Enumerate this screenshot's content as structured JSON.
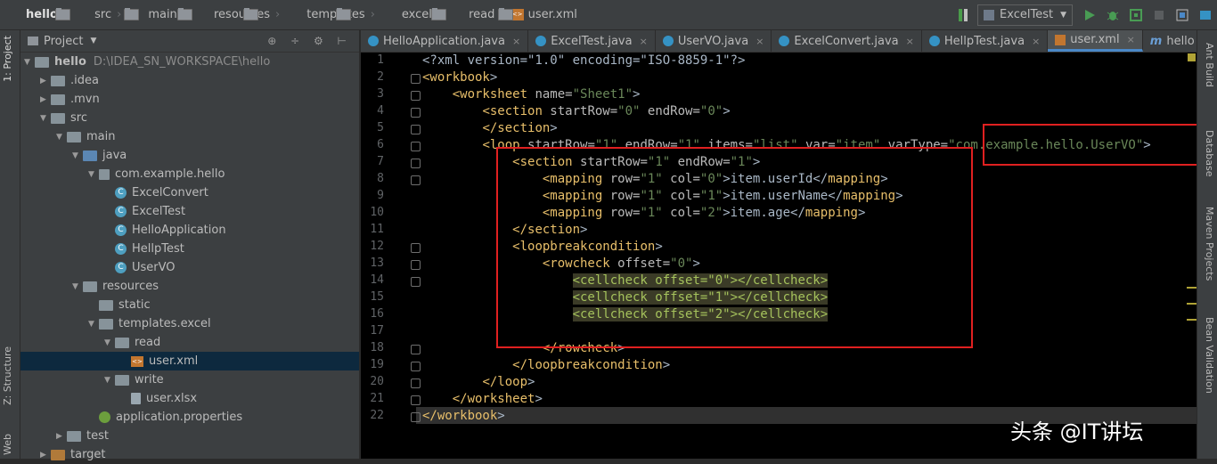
{
  "breadcrumb": [
    "hello",
    "src",
    "main",
    "resources",
    "templates",
    "excel",
    "read",
    "user.xml"
  ],
  "run_config": "ExcelTest",
  "left_tabs": [
    "1: Project",
    "Z: Structure",
    "Web"
  ],
  "right_tabs": [
    "Ant Build",
    "Database",
    "Maven Projects",
    "Bean Validation"
  ],
  "project_panel": {
    "title": "Project",
    "tree": [
      {
        "label": "hello",
        "path": "D:\\IDEA_SN_WORKSPACE\\hello",
        "depth": 0,
        "arrow": "down",
        "icon": "folder"
      },
      {
        "label": ".idea",
        "depth": 1,
        "arrow": "right",
        "icon": "folder"
      },
      {
        "label": ".mvn",
        "depth": 1,
        "arrow": "right",
        "icon": "folder"
      },
      {
        "label": "src",
        "depth": 1,
        "arrow": "down",
        "icon": "folder"
      },
      {
        "label": "main",
        "depth": 2,
        "arrow": "down",
        "icon": "folder"
      },
      {
        "label": "java",
        "depth": 3,
        "arrow": "down",
        "icon": "folder-blue"
      },
      {
        "label": "com.example.hello",
        "depth": 4,
        "arrow": "down",
        "icon": "package"
      },
      {
        "label": "ExcelConvert",
        "depth": 5,
        "arrow": "",
        "icon": "class"
      },
      {
        "label": "ExcelTest",
        "depth": 5,
        "arrow": "",
        "icon": "class"
      },
      {
        "label": "HelloApplication",
        "depth": 5,
        "arrow": "",
        "icon": "class"
      },
      {
        "label": "HellpTest",
        "depth": 5,
        "arrow": "",
        "icon": "class"
      },
      {
        "label": "UserVO",
        "depth": 5,
        "arrow": "",
        "icon": "class"
      },
      {
        "label": "resources",
        "depth": 3,
        "arrow": "down",
        "icon": "folder"
      },
      {
        "label": "static",
        "depth": 4,
        "arrow": "",
        "icon": "folder"
      },
      {
        "label": "templates.excel",
        "depth": 4,
        "arrow": "down",
        "icon": "folder"
      },
      {
        "label": "read",
        "depth": 5,
        "arrow": "down",
        "icon": "folder"
      },
      {
        "label": "user.xml",
        "depth": 6,
        "arrow": "",
        "icon": "xml",
        "selected": true
      },
      {
        "label": "write",
        "depth": 5,
        "arrow": "down",
        "icon": "folder"
      },
      {
        "label": "user.xlsx",
        "depth": 6,
        "arrow": "",
        "icon": "file"
      },
      {
        "label": "application.properties",
        "depth": 4,
        "arrow": "",
        "icon": "leaf"
      },
      {
        "label": "test",
        "depth": 2,
        "arrow": "right",
        "icon": "folder"
      },
      {
        "label": "target",
        "depth": 1,
        "arrow": "right",
        "icon": "folder-orange"
      }
    ]
  },
  "editor_tabs": [
    {
      "label": "HelloApplication.java",
      "icon": "class"
    },
    {
      "label": "ExcelTest.java",
      "icon": "class"
    },
    {
      "label": "UserVO.java",
      "icon": "class"
    },
    {
      "label": "ExcelConvert.java",
      "icon": "class"
    },
    {
      "label": "HellpTest.java",
      "icon": "class"
    },
    {
      "label": "user.xml",
      "icon": "xml",
      "active": true
    },
    {
      "label": "hello",
      "icon": "maven",
      "no_close": true
    }
  ],
  "code_lines": [
    [
      [
        "p",
        "<?xml version=\"1.0\" encoding=\"ISO-8859-1\"?>"
      ]
    ],
    [
      [
        "t",
        "<workbook"
      ],
      [
        "p",
        ">"
      ]
    ],
    [
      [
        "p",
        "    "
      ],
      [
        "t",
        "<worksheet"
      ],
      [
        "a",
        " name="
      ],
      [
        "s",
        "\"Sheet1\""
      ],
      [
        "p",
        ">"
      ]
    ],
    [
      [
        "p",
        "        "
      ],
      [
        "t",
        "<section"
      ],
      [
        "a",
        " startRow="
      ],
      [
        "s",
        "\"0\""
      ],
      [
        "a",
        " endRow="
      ],
      [
        "s",
        "\"0\""
      ],
      [
        "p",
        ">"
      ]
    ],
    [
      [
        "p",
        "        "
      ],
      [
        "t",
        "</section"
      ],
      [
        "p",
        ">"
      ]
    ],
    [
      [
        "p",
        "        "
      ],
      [
        "t",
        "<loop"
      ],
      [
        "a",
        " startRow="
      ],
      [
        "s",
        "\"1\""
      ],
      [
        "a",
        " endRow="
      ],
      [
        "s",
        "\"1\""
      ],
      [
        "a",
        " items="
      ],
      [
        "s",
        "\"list\""
      ],
      [
        "a",
        " var="
      ],
      [
        "s",
        "\"item\""
      ],
      [
        "a",
        " varType="
      ],
      [
        "s",
        "\"com.example.hello.UserVO\""
      ],
      [
        "p",
        ">"
      ]
    ],
    [
      [
        "p",
        "            "
      ],
      [
        "t",
        "<section"
      ],
      [
        "a",
        " startRow="
      ],
      [
        "s",
        "\"1\""
      ],
      [
        "a",
        " endRow="
      ],
      [
        "s",
        "\"1\""
      ],
      [
        "p",
        ">"
      ]
    ],
    [
      [
        "p",
        "                "
      ],
      [
        "t",
        "<mapping"
      ],
      [
        "a",
        " row="
      ],
      [
        "s",
        "\"1\""
      ],
      [
        "a",
        " col="
      ],
      [
        "s",
        "\"0\""
      ],
      [
        "p",
        ">item.userId</"
      ],
      [
        "t",
        "mapping"
      ],
      [
        "p",
        ">"
      ]
    ],
    [
      [
        "p",
        "                "
      ],
      [
        "t",
        "<mapping"
      ],
      [
        "a",
        " row="
      ],
      [
        "s",
        "\"1\""
      ],
      [
        "a",
        " col="
      ],
      [
        "s",
        "\"1\""
      ],
      [
        "p",
        ">item.userName</"
      ],
      [
        "t",
        "mapping"
      ],
      [
        "p",
        ">"
      ]
    ],
    [
      [
        "p",
        "                "
      ],
      [
        "t",
        "<mapping"
      ],
      [
        "a",
        " row="
      ],
      [
        "s",
        "\"1\""
      ],
      [
        "a",
        " col="
      ],
      [
        "s",
        "\"2\""
      ],
      [
        "p",
        ">item.age</"
      ],
      [
        "t",
        "mapping"
      ],
      [
        "p",
        ">"
      ]
    ],
    [
      [
        "p",
        "            "
      ],
      [
        "t",
        "</section"
      ],
      [
        "p",
        ">"
      ]
    ],
    [
      [
        "p",
        "            "
      ],
      [
        "t",
        "<loopbreakcondition"
      ],
      [
        "p",
        ">"
      ]
    ],
    [
      [
        "p",
        "                "
      ],
      [
        "t",
        "<rowcheck"
      ],
      [
        "a",
        " offset="
      ],
      [
        "s",
        "\"0\""
      ],
      [
        "p",
        ">"
      ]
    ],
    [
      [
        "p",
        "                    "
      ],
      [
        "h",
        "<cellcheck offset=\"0\"></cellcheck>"
      ]
    ],
    [
      [
        "p",
        "                    "
      ],
      [
        "h",
        "<cellcheck offset=\"1\"></cellcheck>"
      ]
    ],
    [
      [
        "p",
        "                    "
      ],
      [
        "h",
        "<cellcheck offset=\"2\"></cellcheck>"
      ]
    ],
    [
      [
        "p",
        ""
      ]
    ],
    [
      [
        "p",
        "                "
      ],
      [
        "t",
        "</rowcheck"
      ],
      [
        "p",
        ">"
      ]
    ],
    [
      [
        "p",
        "            "
      ],
      [
        "t",
        "</loopbreakcondition"
      ],
      [
        "p",
        ">"
      ]
    ],
    [
      [
        "p",
        "        "
      ],
      [
        "t",
        "</loop"
      ],
      [
        "p",
        ">"
      ]
    ],
    [
      [
        "p",
        "    "
      ],
      [
        "t",
        "</worksheet"
      ],
      [
        "p",
        ">"
      ]
    ],
    [
      [
        "t",
        "</workbook"
      ],
      [
        "p",
        ">"
      ]
    ]
  ],
  "colors": {
    "tag": "#e8bf6a",
    "attr": "#bababa",
    "string": "#6a8759",
    "plain": "#a9b7c6",
    "highlight_text": "#a5c25c"
  },
  "watermark": "头条 @IT讲坛"
}
